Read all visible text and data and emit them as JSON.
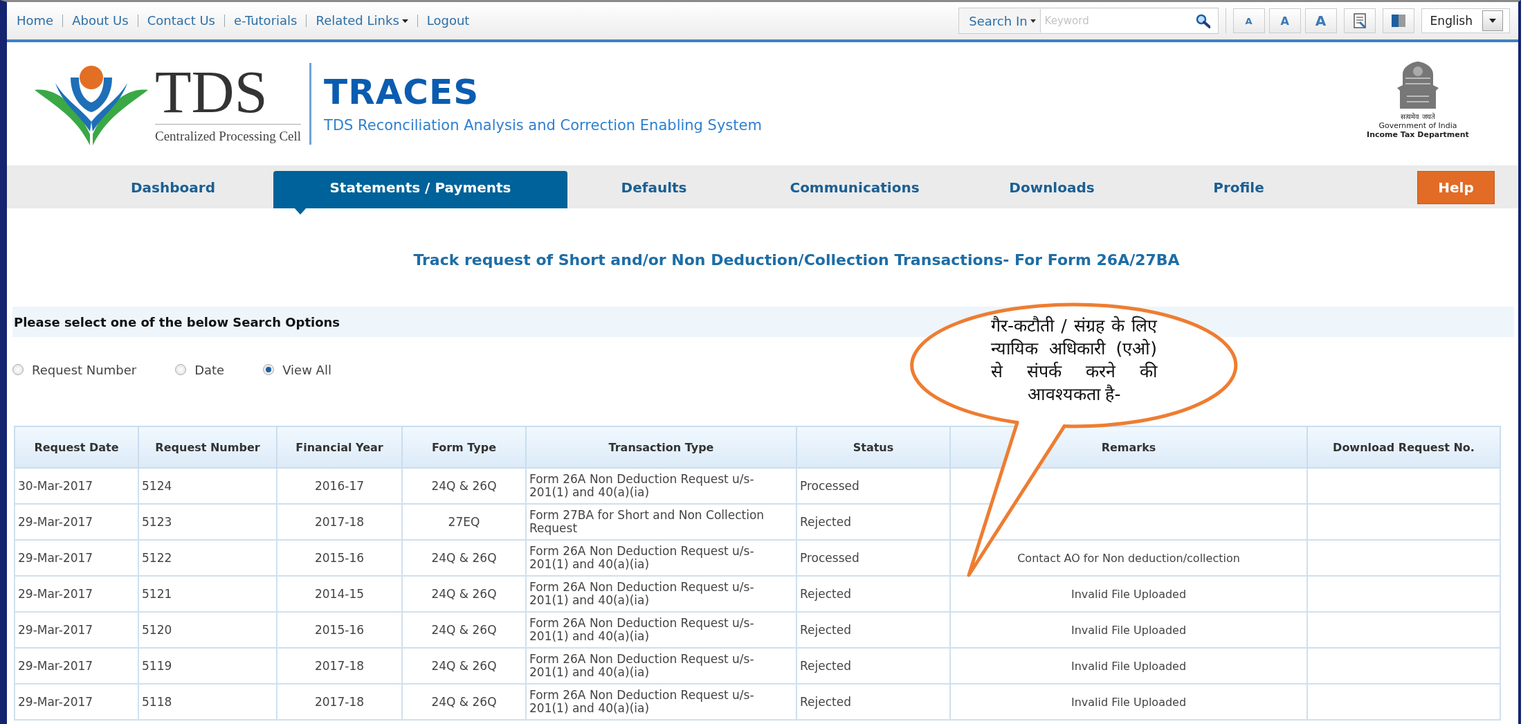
{
  "top_links": [
    {
      "label": "Home",
      "dropdown": false
    },
    {
      "label": "About Us",
      "dropdown": false
    },
    {
      "label": "Contact Us",
      "dropdown": false
    },
    {
      "label": "e-Tutorials",
      "dropdown": false
    },
    {
      "label": "Related Links",
      "dropdown": true
    },
    {
      "label": "Logout",
      "dropdown": false
    }
  ],
  "search": {
    "scope": "Search In",
    "placeholder": "Keyword"
  },
  "font_size_buttons": [
    "A",
    "A",
    "A"
  ],
  "language": "English",
  "logo": {
    "wordmark": "TDS",
    "tagline": "Centralized Processing Cell"
  },
  "system": {
    "name": "TRACES",
    "full_name": "TDS Reconciliation Analysis and Correction Enabling System"
  },
  "department": {
    "motto": "सत्यमेव जयते",
    "line_1": "Government of India",
    "line_2": "Income Tax Department"
  },
  "nav": [
    {
      "label": "Dashboard",
      "kind": "tab",
      "selected": false
    },
    {
      "label": "Statements / Payments",
      "kind": "tab",
      "selected": true
    },
    {
      "label": "Defaults",
      "kind": "tab",
      "selected": false
    },
    {
      "label": "Communications",
      "kind": "tab",
      "selected": false
    },
    {
      "label": "Downloads",
      "kind": "tab",
      "selected": false
    },
    {
      "label": "Profile",
      "kind": "tab",
      "selected": false
    },
    {
      "label": "Help",
      "kind": "help",
      "selected": false
    }
  ],
  "page_title": "Track request of Short and/or Non Deduction/Collection Transactions- For Form 26A/27BA",
  "search_options": {
    "heading": "Please select one of the below Search Options",
    "options": [
      {
        "label": "Request Number",
        "selected": false
      },
      {
        "label": "Date",
        "selected": false
      },
      {
        "label": "View All",
        "selected": true
      }
    ]
  },
  "table": {
    "columns": [
      "Request Date",
      "Request Number",
      "Financial Year",
      "Form Type",
      "Transaction Type",
      "Status",
      "Remarks",
      "Download Request No."
    ],
    "rows": [
      {
        "date": "30-Mar-2017",
        "number": "5124",
        "year": "2016-17",
        "form_type": "24Q & 26Q",
        "transaction_type": "Form 26A Non Deduction Request u/s-201(1) and 40(a)(ia)",
        "status": "Processed"
      },
      {
        "date": "29-Mar-2017",
        "number": "5123",
        "year": "2017-18",
        "form_type": "27EQ",
        "transaction_type": "Form 27BA for Short and Non Collection Request",
        "status": "Rejected"
      },
      {
        "date": "29-Mar-2017",
        "number": "5122",
        "year": "2015-16",
        "form_type": "24Q & 26Q",
        "transaction_type": "Form 26A Non Deduction Request u/s-201(1) and 40(a)(ia)",
        "status": "Processed",
        "remarks": "Contact AO for Non deduction/collection"
      },
      {
        "date": "29-Mar-2017",
        "number": "5121",
        "year": "2014-15",
        "form_type": "24Q & 26Q",
        "transaction_type": "Form 26A Non Deduction Request u/s-201(1) and 40(a)(ia)",
        "status": "Rejected",
        "remarks": "Invalid File Uploaded"
      },
      {
        "date": "29-Mar-2017",
        "number": "5120",
        "year": "2015-16",
        "form_type": "24Q & 26Q",
        "transaction_type": "Form 26A Non Deduction Request u/s-201(1) and 40(a)(ia)",
        "status": "Rejected",
        "remarks": "Invalid File Uploaded"
      },
      {
        "date": "29-Mar-2017",
        "number": "5119",
        "year": "2017-18",
        "form_type": "24Q & 26Q",
        "transaction_type": "Form 26A Non Deduction Request u/s-201(1) and 40(a)(ia)",
        "status": "Rejected",
        "remarks": "Invalid File Uploaded"
      },
      {
        "date": "29-Mar-2017",
        "number": "5118",
        "year": "2017-18",
        "form_type": "24Q & 26Q",
        "transaction_type": "Form 26A Non Deduction Request u/s-201(1) and 40(a)(ia)",
        "status": "Rejected",
        "remarks": "Invalid File Uploaded"
      }
    ]
  },
  "callout": {
    "text": "गैर-कटौती / संग्रह के लिए न्यायिक अधिकारी (एओ) से संपर्क करने की आवश्यकता है-"
  }
}
